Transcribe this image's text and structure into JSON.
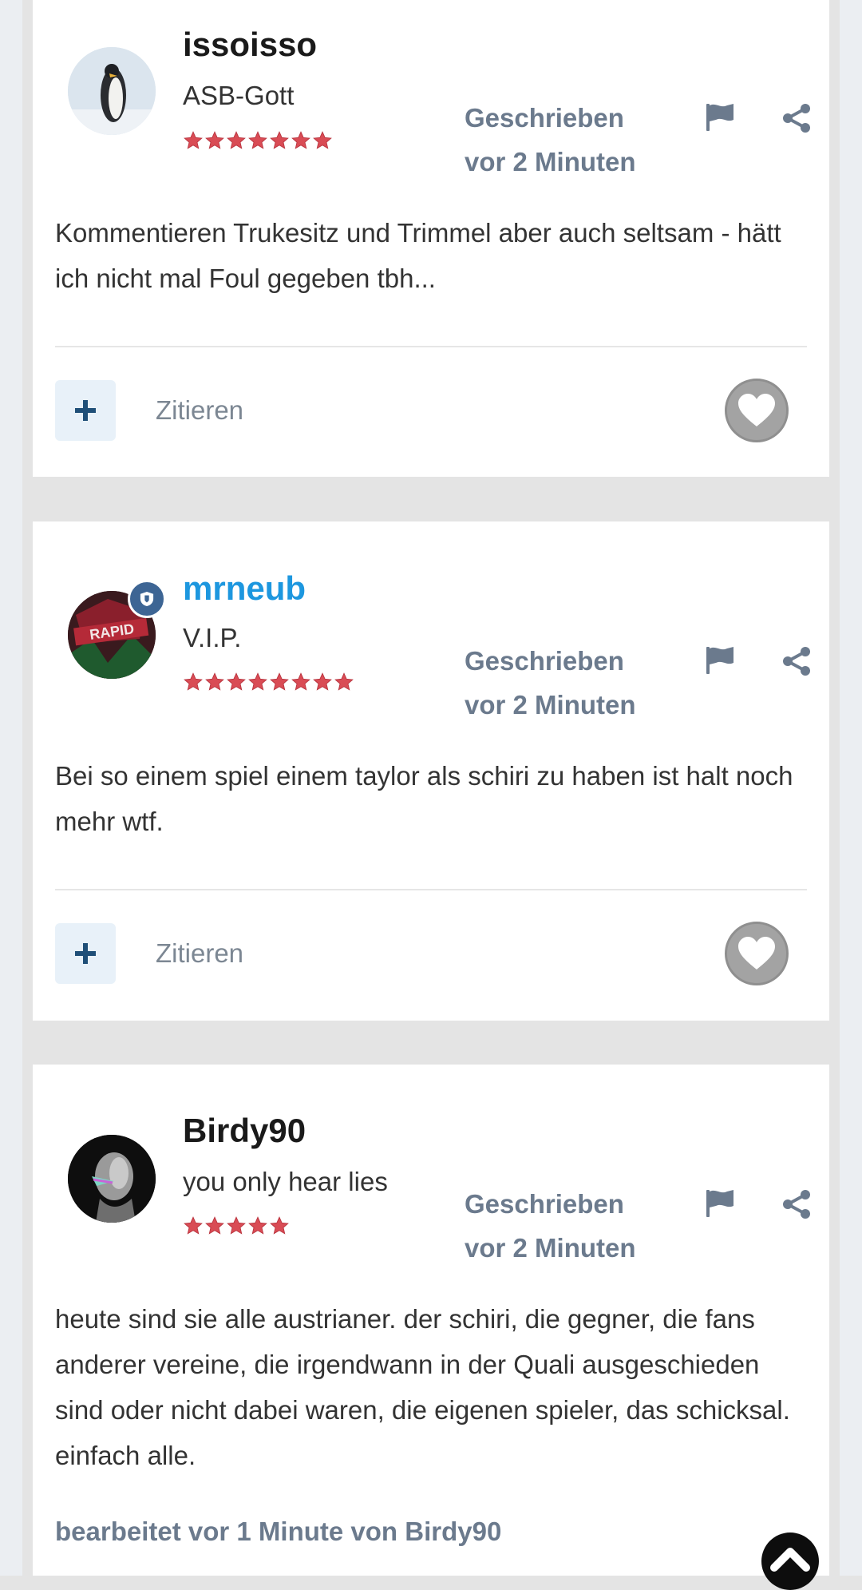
{
  "posts": [
    {
      "username": "issoisso",
      "rank": "ASB-Gott",
      "stars": 7,
      "vip": false,
      "written_label": "Geschrieben vor 2 Minuten",
      "content": "Kommentieren Trukesitz und Trimmel aber auch seltsam - hätt ich nicht mal Foul gegeben tbh...",
      "quote_label": "Zitieren",
      "avatar_icon": "penguin-avatar"
    },
    {
      "username": "mrneub",
      "rank": "V.I.P.",
      "stars": 8,
      "vip": true,
      "written_label": "Geschrieben vor 2 Minuten",
      "content": "Bei so einem spiel einem taylor als schiri zu haben ist halt noch mehr wtf.",
      "quote_label": "Zitieren",
      "avatar_icon": "rapid-avatar"
    },
    {
      "username": "Birdy90",
      "rank": "you only hear lies",
      "stars": 5,
      "vip": false,
      "written_label": "Geschrieben vor 2 Minuten",
      "content": "heute sind sie alle austrianer. der schiri, die gegner, die fans anderer vereine, die irgendwann in der Quali ausgeschieden sind oder nicht dabei waren, die eigenen spieler, das schicksal. einfach alle.",
      "edited_label": "bearbeitet vor 1 Minute von Birdy90",
      "avatar_icon": "statue-avatar"
    }
  ],
  "colors": {
    "vip_name": "#1d97df",
    "meta_text": "#6b7a8d",
    "star_fill": "#d94c55",
    "badge": "#3d6594"
  }
}
